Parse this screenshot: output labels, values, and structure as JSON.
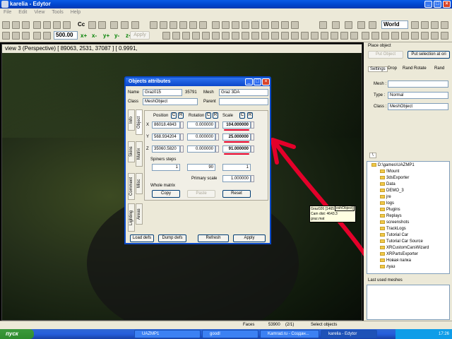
{
  "window": {
    "title": "karelia - Edytor"
  },
  "menu": [
    "File",
    "Edit",
    "View",
    "Tools",
    "Help"
  ],
  "toolbar": {
    "step_value": "500.00",
    "apply_label": "Apply",
    "axes": [
      "x+",
      "x-",
      "y+",
      "y-",
      "z+",
      "z-"
    ],
    "world_select": "World",
    "cc_label": "Cc"
  },
  "viewport": {
    "header": "view 3 (Perspective) [ 89063,   2531,  37087 ] [ 0.9991,"
  },
  "dialog": {
    "title": "Objects attributes",
    "name_label": "Name",
    "name_value": "Graz015",
    "id_value": "35791",
    "mesh_label": "Mesh",
    "mesh_value": "Graz 3DA",
    "class_label": "Class",
    "class_value": "MeshObject",
    "parent_label": "Parent",
    "side_tabs": [
      "Info",
      "Object",
      "Skins",
      "Matrix",
      "Comment",
      "Misc",
      "Lighting",
      "Areas"
    ],
    "col_position": "Position",
    "col_rotation": "Rotation",
    "col_scale": "Scale",
    "c_label": "C",
    "r_label": "R",
    "rows": [
      {
        "axis": "X",
        "position": "86018.4843",
        "rotation": "0.000000",
        "scale": "104.000000"
      },
      {
        "axis": "Y",
        "position": "568.934204",
        "rotation": "0.000000",
        "scale": "25.000000"
      },
      {
        "axis": "Z",
        "position": "35060.5820",
        "rotation": "0.000000",
        "scale": "91.000000"
      }
    ],
    "spiners_label": "Spiners steps",
    "spin_values": [
      "1",
      "90",
      "1"
    ],
    "primary_scale_label": "Primary scale",
    "primary_scale_value": "1.000000",
    "whole_matrix_label": "Whole matrix",
    "copy_label": "Copy",
    "paste_label": "Paste",
    "reset_label": "Reset",
    "load_defs": "Load defs",
    "dump_defs": "Dump defs",
    "refresh": "Refresh",
    "apply": "Apply"
  },
  "tooltip": {
    "lines": [
      "Graz026 [1465",
      "Cam dist: 4643.3",
      "graz.mat"
    ],
    "tail": "eshObject]"
  },
  "right_panel": {
    "place_object": "Place object",
    "put_object": "Put Object",
    "put_selection": "Put selection at ori",
    "tabs": [
      "Settings",
      "Drop",
      "Rand Rotate",
      "Rand"
    ],
    "mesh_label": "Mesh :",
    "type_label": "Type :",
    "type_value": "Normal",
    "class_label": "Class :",
    "class_value": "MeshObject",
    "slash_tab": "\\",
    "tree": [
      "D:\\games\\UAZMP1",
      "!Mount",
      "3dsExporter",
      "Data",
      "DEMO_3",
      "jre",
      "logs",
      "Plugins",
      "Replays",
      "screenshots",
      "TrackLogs",
      "Tutorial Car",
      "Tutorial Car Source",
      "XRCustomCarsWizard",
      "XRPartsExporter",
      "Новая папка",
      "луаз"
    ],
    "last_used": "Last used meshes"
  },
  "status": {
    "faces_label": "Faces",
    "faces_value": "53900",
    "sel_value": "(2/1)",
    "hint": "Select objects"
  },
  "taskbar": {
    "start": "пуск",
    "items": [
      "UAZMP1",
      "goodl",
      "Kamrad.ru - Создан...",
      "karelia - Edytor"
    ],
    "clock": "17:26"
  }
}
